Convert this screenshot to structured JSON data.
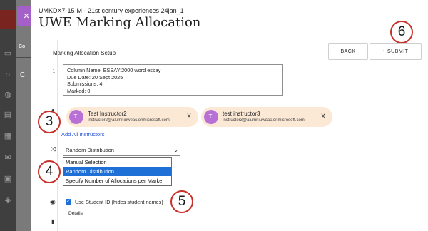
{
  "background": {
    "tab_label": "Co",
    "heading_fragment": "C"
  },
  "header": {
    "breadcrumb": "UMKDX7-15-M - 21st century experiences 24jan_1",
    "title": "UWE Marking Allocation",
    "close_glyph": "×"
  },
  "setup": {
    "label": "Marking Allocation Setup",
    "back_label": "BACK",
    "submit_label": "SUBMIT",
    "submit_icon": "↑"
  },
  "assignment_info": {
    "icon": "i",
    "lines": [
      "Column Name:   ESSAY:2000 word essay",
      "Due Date:   20 Sept 2025",
      "Submissions:   4",
      "Marked:   0"
    ]
  },
  "instructors": [
    {
      "initials": "TI",
      "name": "Test Instructor2",
      "email": "instructor2@alumniuweac.onmicrosoft.com",
      "remove": "X"
    },
    {
      "initials": "TI",
      "name": "test instructor3",
      "email": "instructor3@alumniuweac.onmicrosoft.com",
      "remove": "X"
    }
  ],
  "add_all_label": "Add All Instructors",
  "distribution": {
    "selected": "Random Distribution",
    "caret": "⌄",
    "options": [
      "Manual Selection",
      "Random Distribution",
      "Specify Number of Allocations per Marker"
    ],
    "highlighted_index": 1
  },
  "anonymity": {
    "checked": true,
    "label": "Use Student ID (hides student names)"
  },
  "details_label": "Details",
  "callouts": [
    "3",
    "4",
    "5",
    "6"
  ],
  "colors": {
    "accent_purple": "#a460c8",
    "chip_bg": "#fbe8d5",
    "selection_blue": "#1e6fd6",
    "link_blue": "#2a55d8",
    "callout_red": "#c8312b"
  }
}
